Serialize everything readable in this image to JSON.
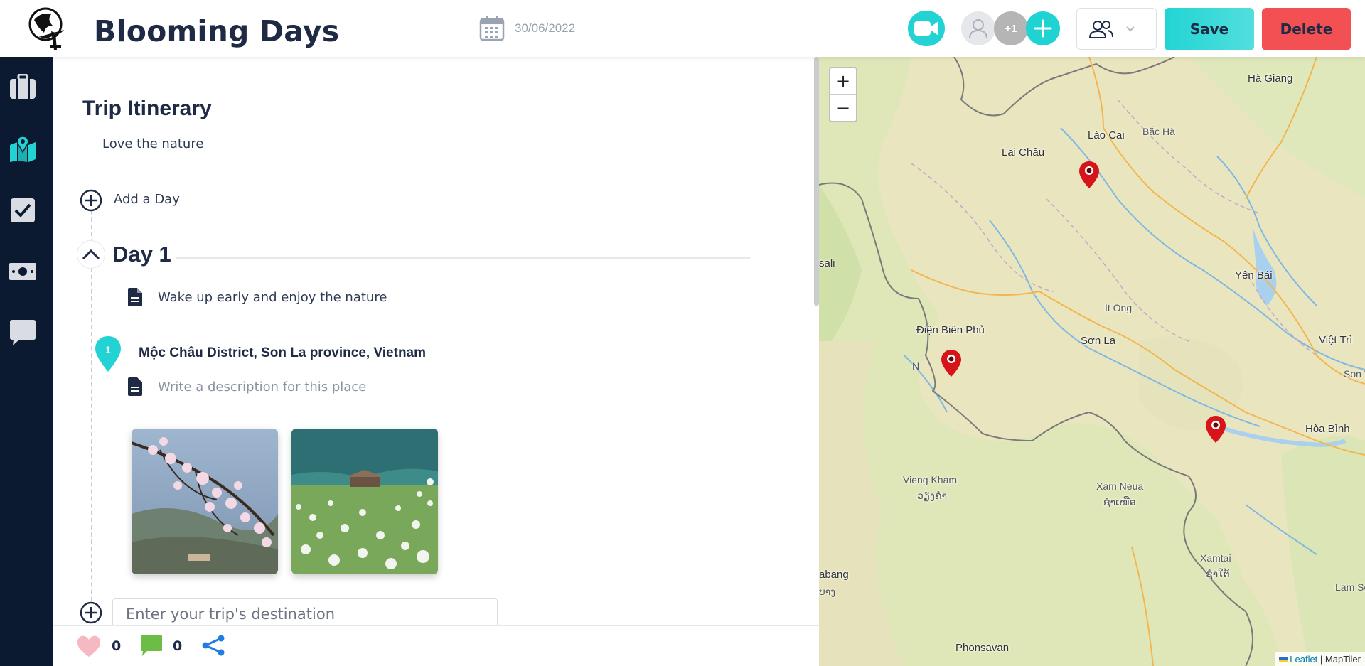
{
  "header": {
    "title": "Blooming Days",
    "date": "30/06/2022",
    "avatar_extra": "+1",
    "save_label": "Save",
    "delete_label": "Delete"
  },
  "sidebar": {
    "items": [
      {
        "name": "trip",
        "icon": "briefcase-icon"
      },
      {
        "name": "map",
        "icon": "map-pin-icon",
        "active": true
      },
      {
        "name": "checklist",
        "icon": "checkbox-icon"
      },
      {
        "name": "budget",
        "icon": "money-icon"
      },
      {
        "name": "chat",
        "icon": "chat-icon"
      }
    ]
  },
  "itinerary": {
    "heading": "Trip Itinerary",
    "subtitle": "Love the nature",
    "add_day_label": "Add a Day",
    "day": {
      "title": "Day 1",
      "note": "Wake up early and enjoy the nature",
      "place": {
        "number": "1",
        "name": "Mộc Châu District, Son La province, Vietnam",
        "description_placeholder": "Write a description for this place"
      }
    },
    "destination_placeholder": "Enter your trip's destination"
  },
  "footer": {
    "likes": "0",
    "comments": "0"
  },
  "map": {
    "zoom_in": "+",
    "zoom_out": "−",
    "cities": [
      "Hà Giang",
      "Lào Cai",
      "Bắc Hà",
      "Lai Châu",
      "Yên Bái",
      "It Ong",
      "Điện Biên Phủ",
      "Sơn La",
      "Việt Trì",
      "Son T",
      "sali",
      "Hòa Bình",
      "Vieng Kham",
      "ວຽງຄຳ",
      "Xam Neua",
      "ຊຳເໜືອ",
      "Xamtai",
      "ຊຳໃຕ້",
      "abang",
      "ບາງ",
      "Lam Son",
      "Phonsavan",
      "N"
    ],
    "attribution_leaflet": "Leaflet",
    "attribution_rest": " | MapTiler"
  },
  "colors": {
    "accent": "#23d3d3",
    "sidebar_bg": "#0b1a30",
    "delete": "#f25052",
    "marker": "#d7141a"
  }
}
